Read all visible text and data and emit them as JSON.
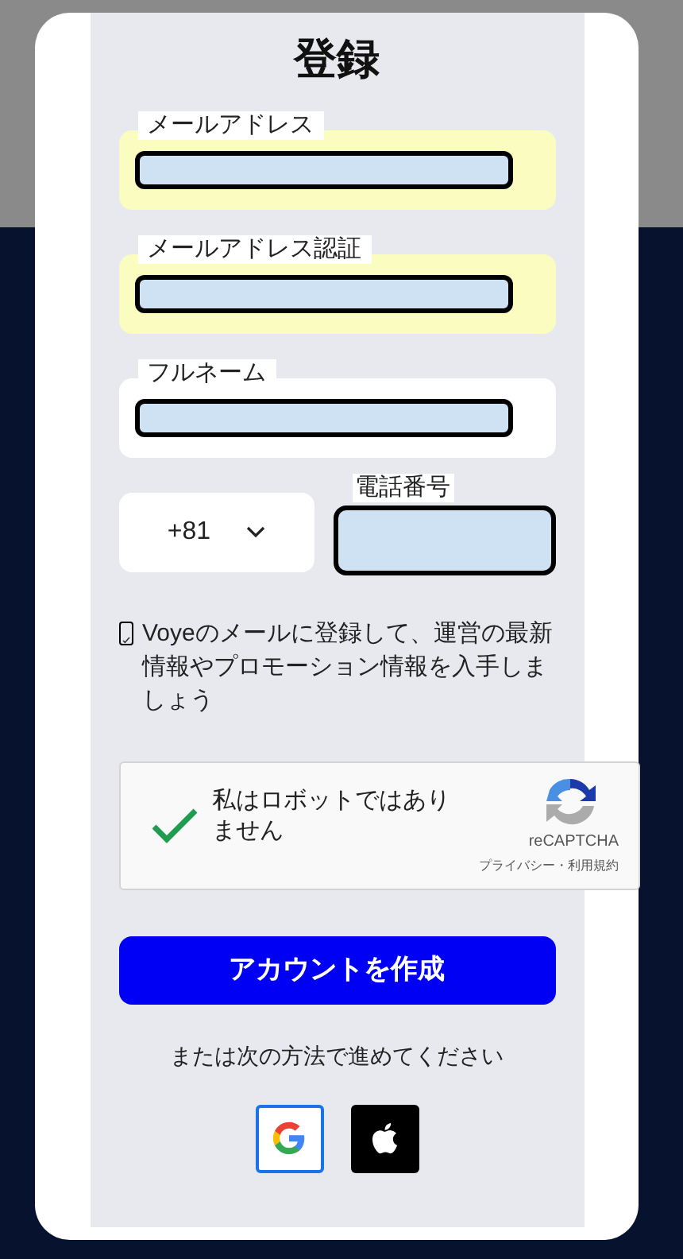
{
  "dialog": {
    "title": "登録",
    "fields": [
      {
        "label": "メールアドレス",
        "highlighted": true
      },
      {
        "label": "メールアドレス認証",
        "highlighted": true
      },
      {
        "label": "フルネーム",
        "highlighted": false
      }
    ],
    "phone": {
      "country_code": "+81",
      "label": "電話番号"
    },
    "newsletter": {
      "checked": true,
      "text": "Voyeのメールに登録して、運営の最新情報やプロモーション情報を入手しましょう"
    },
    "captcha": {
      "checked": true,
      "text": "私はロボットではありません",
      "brand": "reCAPTCHA",
      "links": "プライバシー・利用規約"
    },
    "submit": "アカウントを作成",
    "alt_text": "または次の方法で進めてください",
    "social": [
      {
        "kind": "google"
      },
      {
        "kind": "apple"
      }
    ]
  }
}
